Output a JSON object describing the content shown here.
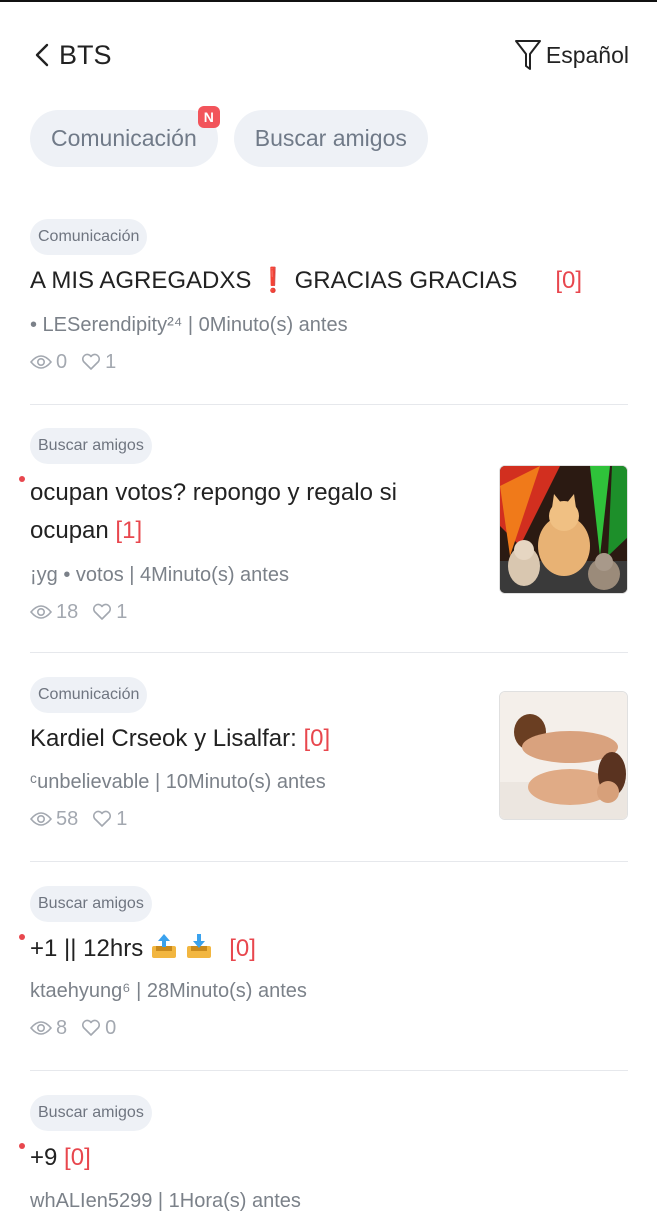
{
  "header": {
    "title": "BTS",
    "language": "Español"
  },
  "tabs": [
    {
      "label": "Comunicación",
      "badge": "N"
    },
    {
      "label": "Buscar amigos"
    }
  ],
  "posts": [
    {
      "tag": "Comunicación",
      "headline": "A MIS AGREGADXS ❗ GRACIAS GRACIAS",
      "count": "[0]",
      "meta": "• LESerendipity²⁴ | 0Minuto(s) antes",
      "views": "0",
      "likes": "1"
    },
    {
      "tag": "Buscar amigos",
      "headline": "ocupan votos? repongo y regalo si ocupan",
      "count": "[1]",
      "meta": "¡yg • votos | 4Minuto(s) antes",
      "views": "18",
      "likes": "1"
    },
    {
      "tag": "Comunicación",
      "headline": "Kardiel Crseok y Lisalfar:",
      "count": "[0]",
      "meta": "ᶜunbelievable | 10Minuto(s) antes",
      "views": "58",
      "likes": "1"
    },
    {
      "tag": "Buscar amigos",
      "headline": "+1 || 12hrs",
      "count": "[0]",
      "meta": "ktaehyung⁶ | 28Minuto(s) antes",
      "views": "8",
      "likes": "0"
    },
    {
      "tag": "Buscar amigos",
      "headline": "+9",
      "count": "[0]",
      "meta": "whALIen5299 | 1Hora(s) antes"
    }
  ],
  "colors": {
    "accent": "#e8474e",
    "chip_bg": "#eef1f6",
    "badge": "#f2545b"
  }
}
